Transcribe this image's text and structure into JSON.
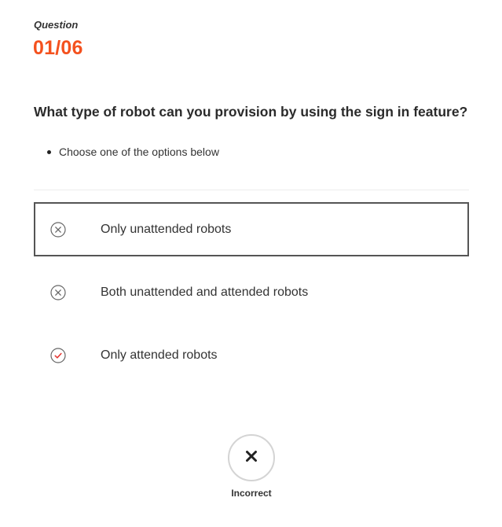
{
  "header": {
    "label": "Question",
    "number": "01/06"
  },
  "question": {
    "text": "What type of robot can you provision by using the sign in feature?",
    "instructions": [
      "Choose one of the options below"
    ]
  },
  "options": [
    {
      "label": "Only unattended robots",
      "icon": "x-circle-icon",
      "selected": true
    },
    {
      "label": "Both unattended and attended robots",
      "icon": "x-circle-icon",
      "selected": false
    },
    {
      "label": "Only attended robots",
      "icon": "check-circle-icon",
      "selected": false
    }
  ],
  "result": {
    "icon": "x-icon",
    "label": "Incorrect"
  },
  "colors": {
    "accent": "#f4511e",
    "correct": "#e53935",
    "neutral": "#666666"
  }
}
